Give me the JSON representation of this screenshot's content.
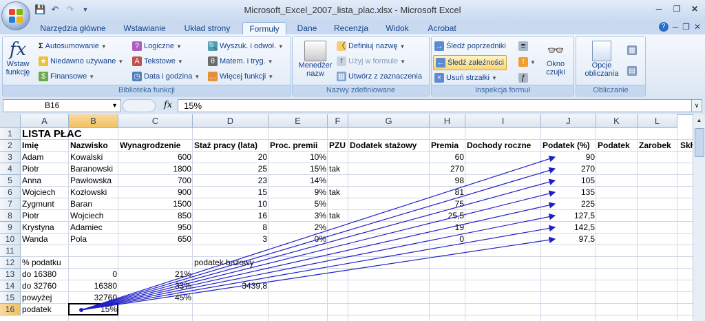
{
  "window": {
    "title": "Microsoft_Excel_2007_lista_plac.xlsx - Microsoft Excel",
    "qat": [
      "save-icon",
      "undo-icon",
      "redo-icon",
      "customize-icon"
    ]
  },
  "tabs": [
    "Narzędzia główne",
    "Wstawianie",
    "Układ strony",
    "Formuły",
    "Dane",
    "Recenzja",
    "Widok",
    "Acrobat"
  ],
  "active_tab": "Formuły",
  "ribbon": {
    "biblioteka": {
      "label": "Biblioteka funkcji",
      "insert_fn": "Wstaw funkcję",
      "items": [
        "Autosumowanie",
        "Niedawno używane",
        "Finansowe",
        "Logiczne",
        "Tekstowe",
        "Data i godzina",
        "Wyszuk. i odwoł.",
        "Matem. i tryg.",
        "Więcej funkcji"
      ]
    },
    "nazwy": {
      "label": "Nazwy zdefiniowane",
      "manager": "Menedżer nazw",
      "items": [
        "Definiuj nazwę",
        "Użyj w formule",
        "Utwórz z zaznaczenia"
      ]
    },
    "inspekcja": {
      "label": "Inspekcja formuł",
      "items": [
        "Śledź poprzedniki",
        "Śledź zależności",
        "Usuń strzałki"
      ],
      "watch": "Okno czujki"
    },
    "obliczanie": {
      "label": "Obliczanie",
      "options": "Opcje obliczania"
    }
  },
  "formula_bar": {
    "name_box": "B16",
    "fx": "fx",
    "formula": "15%"
  },
  "selected_cell": "B16",
  "columns": [
    "A",
    "B",
    "C",
    "D",
    "E",
    "F",
    "G",
    "H",
    "I",
    "J",
    "K",
    "L"
  ],
  "rows": [
    "1",
    "2",
    "3",
    "4",
    "5",
    "6",
    "7",
    "8",
    "9",
    "10",
    "11",
    "12",
    "13",
    "14",
    "15",
    "16"
  ],
  "sheet": {
    "title": "LISTA PŁAC",
    "headers": [
      "Imię",
      "Nazwisko",
      "Wynagrodzenie",
      "Staż pracy (lata)",
      "Proc. premii",
      "PZU",
      "Dodatek stażowy",
      "Premia",
      "Dochody roczne",
      "Podatek (%)",
      "Podatek",
      "Zarobek",
      "Skł"
    ],
    "employees": [
      [
        "Adam",
        "Kowalski",
        "600",
        "20",
        "10%",
        "",
        "",
        "60",
        "",
        "90"
      ],
      [
        "Piotr",
        "Baranowski",
        "1800",
        "25",
        "15%",
        "tak",
        "",
        "270",
        "",
        "270"
      ],
      [
        "Anna",
        "Pawłowska",
        "700",
        "23",
        "14%",
        "",
        "",
        "98",
        "",
        "105"
      ],
      [
        "Wojciech",
        "Kozłowski",
        "900",
        "15",
        "9%",
        "tak",
        "",
        "81",
        "",
        "135"
      ],
      [
        "Zygmunt",
        "Baran",
        "1500",
        "10",
        "5%",
        "",
        "",
        "75",
        "",
        "225"
      ],
      [
        "Piotr",
        "Wojciech",
        "850",
        "16",
        "3%",
        "tak",
        "",
        "25,5",
        "",
        "127,5"
      ],
      [
        "Krystyna",
        "Adamiec",
        "950",
        "8",
        "2%",
        "",
        "",
        "19",
        "",
        "142,5"
      ],
      [
        "Wanda",
        "Pola",
        "650",
        "3",
        "0%",
        "",
        "",
        "0",
        "",
        "97,5"
      ]
    ],
    "r12_a": "% podatku",
    "r12_d": "podatek bazowy",
    "tax_rows": [
      [
        "do 16380",
        "0",
        "21%",
        ""
      ],
      [
        "do 32760",
        "16380",
        "33%",
        "3439,8"
      ],
      [
        "powyżej",
        "32760",
        "45%",
        ""
      ]
    ],
    "r16_a": "podatek",
    "r16_b": "15%"
  },
  "trace_arrow_color": "#1f1fc8"
}
